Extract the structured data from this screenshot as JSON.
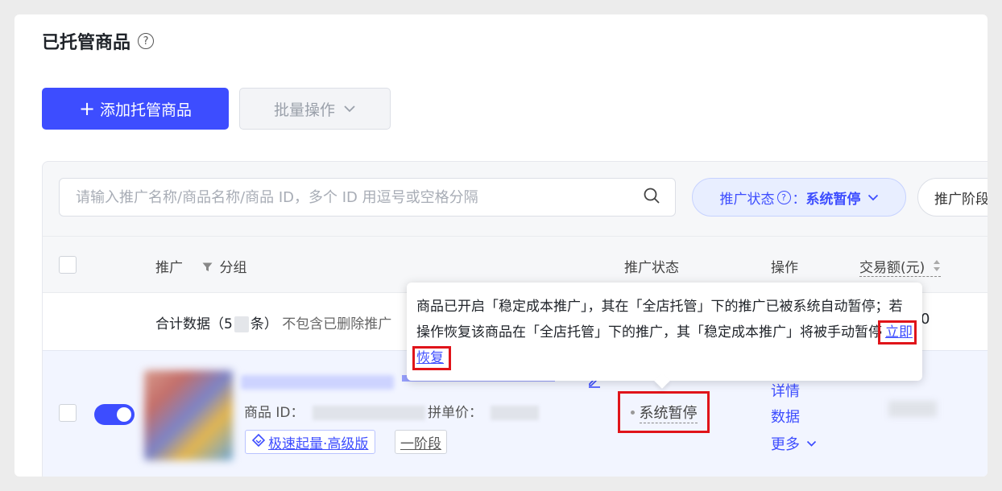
{
  "page": {
    "title": "已托管商品",
    "help_icon": "?"
  },
  "toolbar": {
    "add_label": "添加托管商品",
    "add_icon": "+",
    "batch_label": "批量操作"
  },
  "filters": {
    "search_placeholder": "请输入推广名称/商品名称/商品 ID，多个 ID 用逗号或空格分隔",
    "status_label": "推广状态",
    "status_help": "?",
    "status_value": "系统暂停",
    "stage_label": "推广阶段"
  },
  "table": {
    "headers": {
      "promo": "推广",
      "group": "分组",
      "status": "推广状态",
      "action": "操作",
      "amount": "交易额(元)"
    },
    "summary": {
      "label_prefix": "合计数据（5",
      "label_suffix": "条）",
      "note": "不包含已删除推广",
      "amount": "0"
    },
    "row": {
      "product_id_label": "商品 ID：",
      "price_label": "拼单价：",
      "plan_tag": "极速起量·高级版",
      "stage_tag": "一阶段",
      "status": "系统暂停",
      "actions": {
        "detail": "详情",
        "data": "数据",
        "more": "更多"
      }
    }
  },
  "tooltip": {
    "text": "商品已开启「稳定成本推广」，其在「全店托管」下的推广已被系统自动暂停；若操作恢复该商品在「全店托管」下的推广，其「稳定成本推广」将被手动暂停",
    "link": "立即恢复"
  },
  "colors": {
    "primary": "#3d4dff",
    "highlight_box": "#e0141a",
    "row_bg": "#f2f5ff"
  }
}
